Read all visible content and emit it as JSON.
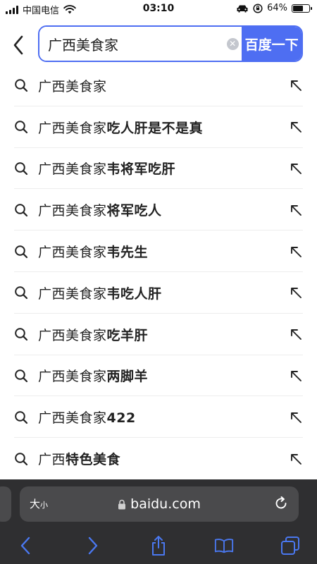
{
  "status_bar": {
    "carrier": "中国电信",
    "time": "03:10",
    "battery_text": "64%",
    "battery_level": 0.64
  },
  "search": {
    "query": "广西美食家",
    "submit_label": "百度一下",
    "accent_color": "#4e6ef2"
  },
  "suggestions": [
    {
      "prefix": "广西美食家",
      "suffix": ""
    },
    {
      "prefix": "广西美食家",
      "suffix": "吃人肝是不是真"
    },
    {
      "prefix": "广西美食家",
      "suffix": "韦将军吃肝"
    },
    {
      "prefix": "广西美食家",
      "suffix": "将军吃人"
    },
    {
      "prefix": "广西美食家",
      "suffix": "韦先生"
    },
    {
      "prefix": "广西美食家",
      "suffix": "韦吃人肝"
    },
    {
      "prefix": "广西美食家",
      "suffix": "吃羊肝"
    },
    {
      "prefix": "广西美食家",
      "suffix": "两脚羊"
    },
    {
      "prefix": "广西美食家",
      "suffix": "422"
    },
    {
      "prefix": "广西",
      "suffix": "特色美食"
    }
  ],
  "browser": {
    "text_size_big": "大",
    "text_size_small": "小",
    "url": "baidu.com",
    "icons": [
      "lock-icon",
      "reload-icon",
      "back-icon",
      "forward-icon",
      "share-icon",
      "bookmarks-icon",
      "tabs-icon"
    ]
  }
}
